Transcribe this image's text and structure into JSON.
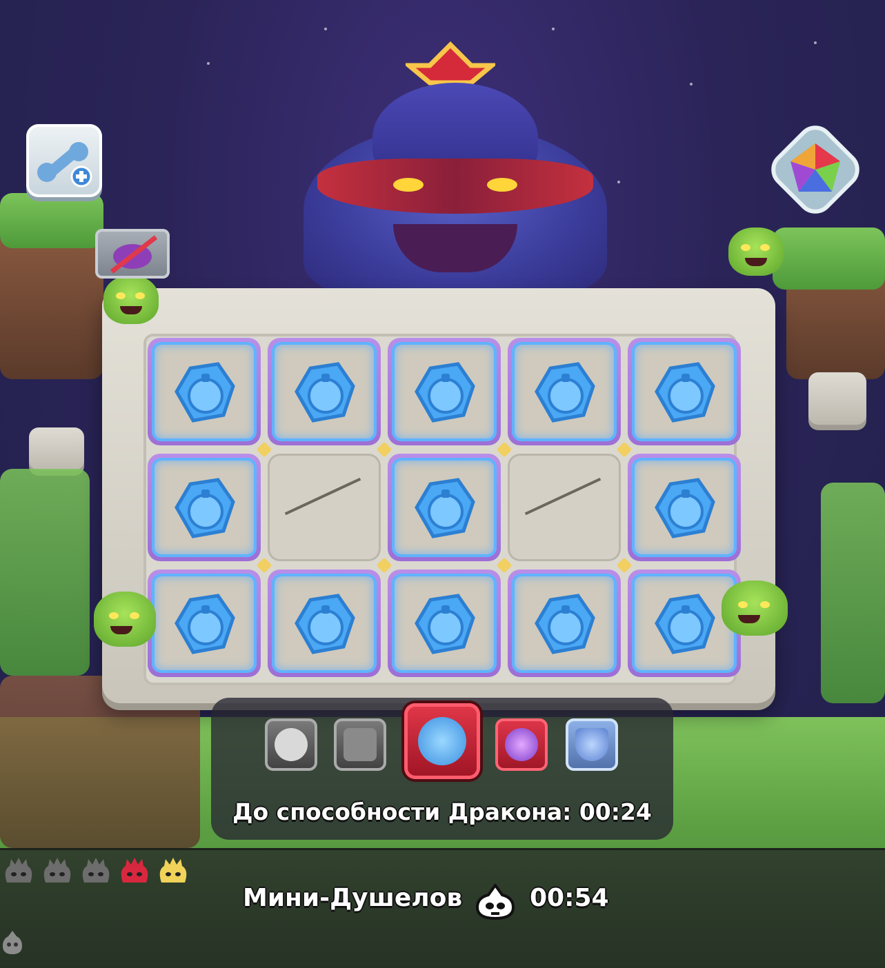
{
  "ability_panel": {
    "timer_label": "До способности Дракона: 00:24",
    "abilities": [
      {
        "icon": "snow-cloud-download-icon",
        "state": "disabled"
      },
      {
        "icon": "dark-mask-icon",
        "state": "disabled"
      },
      {
        "icon": "potion-jar-icon",
        "state": "active"
      },
      {
        "icon": "purple-crystal-icon",
        "state": "available"
      },
      {
        "icon": "shield-face-icon",
        "state": "available"
      }
    ]
  },
  "wave": {
    "name": "Мини-Душелов",
    "timer": "00:54",
    "icon": "ghost-skull-icon",
    "mini_bosses": [
      {
        "color": "#6d6d6d",
        "state": "defeated"
      },
      {
        "color": "#6d6d6d",
        "state": "defeated"
      },
      {
        "color": "#6d6d6d",
        "state": "defeated"
      },
      {
        "color": "#d8283f",
        "state": "current"
      },
      {
        "color": "#f1d35a",
        "state": "upcoming"
      }
    ]
  },
  "board": {
    "rows": 3,
    "cols": 5,
    "cells": [
      "potion",
      "potion",
      "potion",
      "potion",
      "potion",
      "potion",
      "empty",
      "potion",
      "empty",
      "potion",
      "potion",
      "potion",
      "potion",
      "potion",
      "potion"
    ]
  },
  "buttons": {
    "upgrade": "wrench-plus-icon",
    "prism": "rainbow-prism-icon",
    "hide_mask": "mask-crossed-icon"
  },
  "colors": {
    "accent_red": "#d8283f",
    "tile_glow": "#5fb3ff",
    "tile_frame": "#9c6fd6"
  }
}
